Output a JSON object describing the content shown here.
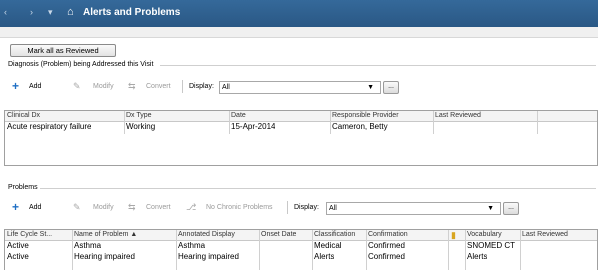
{
  "window": {
    "title": "Alerts and Problems",
    "nav_back": "‹",
    "nav_forward": "›",
    "nav_dropdown": "▾"
  },
  "actions": {
    "mark_all_reviewed": "Mark all as Reviewed"
  },
  "diagnosis_section": {
    "label": "Diagnosis (Problem) being Addressed this Visit",
    "toolbar": {
      "add": "Add",
      "modify": "Modify",
      "convert": "Convert",
      "display_label": "Display:",
      "display_value": "All"
    },
    "columns": [
      "Clinical Dx",
      "Dx Type",
      "Date",
      "Responsible Provider",
      "Last Reviewed"
    ],
    "rows": [
      {
        "clinical_dx": "Acute respiratory failure",
        "dx_type": "Working",
        "date": "15-Apr-2014",
        "provider": "Cameron, Betty",
        "last_reviewed": ""
      }
    ]
  },
  "problems_section": {
    "label": "Problems",
    "toolbar": {
      "add": "Add",
      "modify": "Modify",
      "convert": "Convert",
      "no_chronic": "No Chronic Problems",
      "display_label": "Display:",
      "display_value": "All"
    },
    "columns": [
      "Life Cycle St...",
      "Name of Problem ▲",
      "Annotated Display",
      "Onset Date",
      "Classification",
      "Confirmation",
      "",
      "Vocabulary",
      "Last Reviewed"
    ],
    "rows": [
      {
        "status": "Active",
        "name": "Asthma",
        "annotated": "Asthma",
        "onset": "",
        "classification": "Medical",
        "confirmation": "Confirmed",
        "vocabulary": "SNOMED CT",
        "last_reviewed": ""
      },
      {
        "status": "Active",
        "name": "Hearing impaired",
        "annotated": "Hearing impaired",
        "onset": "",
        "classification": "Alerts",
        "confirmation": "Confirmed",
        "vocabulary": "Alerts",
        "last_reviewed": ""
      }
    ]
  },
  "icons": {
    "home": "home-icon",
    "add": "plus-icon",
    "modify": "pencil-icon",
    "convert": "convert-arrows-icon",
    "no_chronic": "no-chronic-icon",
    "dropdown": "chevron-down-icon",
    "ellipsis": "ellipsis-icon",
    "vocab_header": "book-icon"
  },
  "colors": {
    "titlebar": "#2f5f8f",
    "add_icon": "#1f6fc4",
    "vocab_icon": "#d8a520"
  }
}
